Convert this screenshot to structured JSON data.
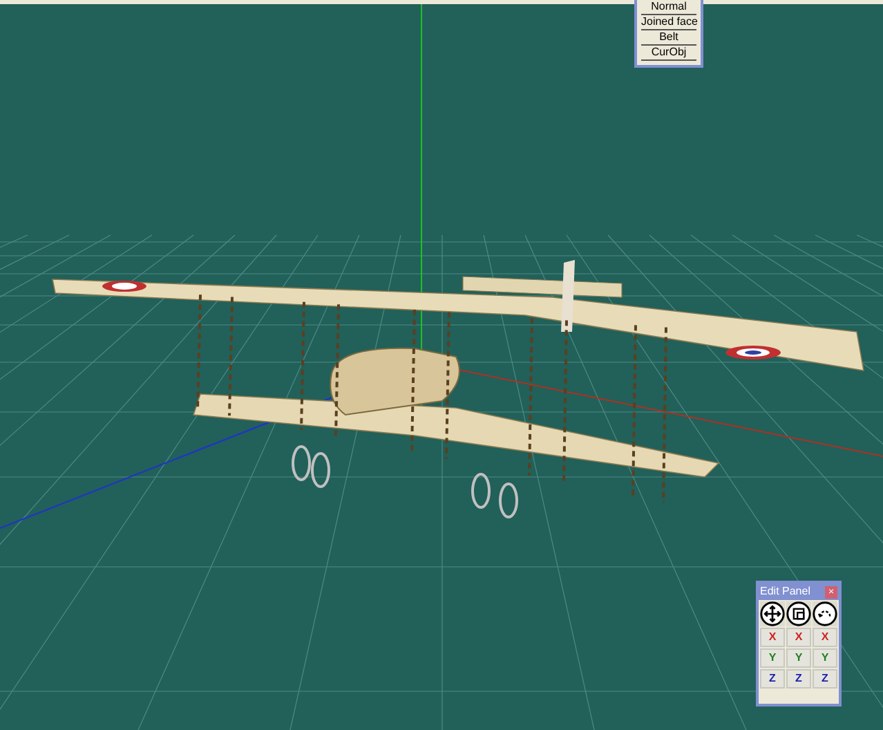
{
  "selection_menu": {
    "items": [
      "Normal",
      "Joined face",
      "Belt",
      "CurObj"
    ]
  },
  "edit_panel": {
    "title": "Edit Panel",
    "close": "×",
    "tools": [
      {
        "kind": "move"
      },
      {
        "kind": "scale"
      },
      {
        "kind": "rotate"
      }
    ],
    "rows": [
      {
        "color": "#d02020",
        "buttons": [
          "X",
          "X",
          "X"
        ]
      },
      {
        "color": "#208020",
        "buttons": [
          "Y",
          "Y",
          "Y"
        ]
      },
      {
        "color": "#2020b0",
        "buttons": [
          "Z",
          "Z",
          "Z"
        ]
      }
    ]
  }
}
